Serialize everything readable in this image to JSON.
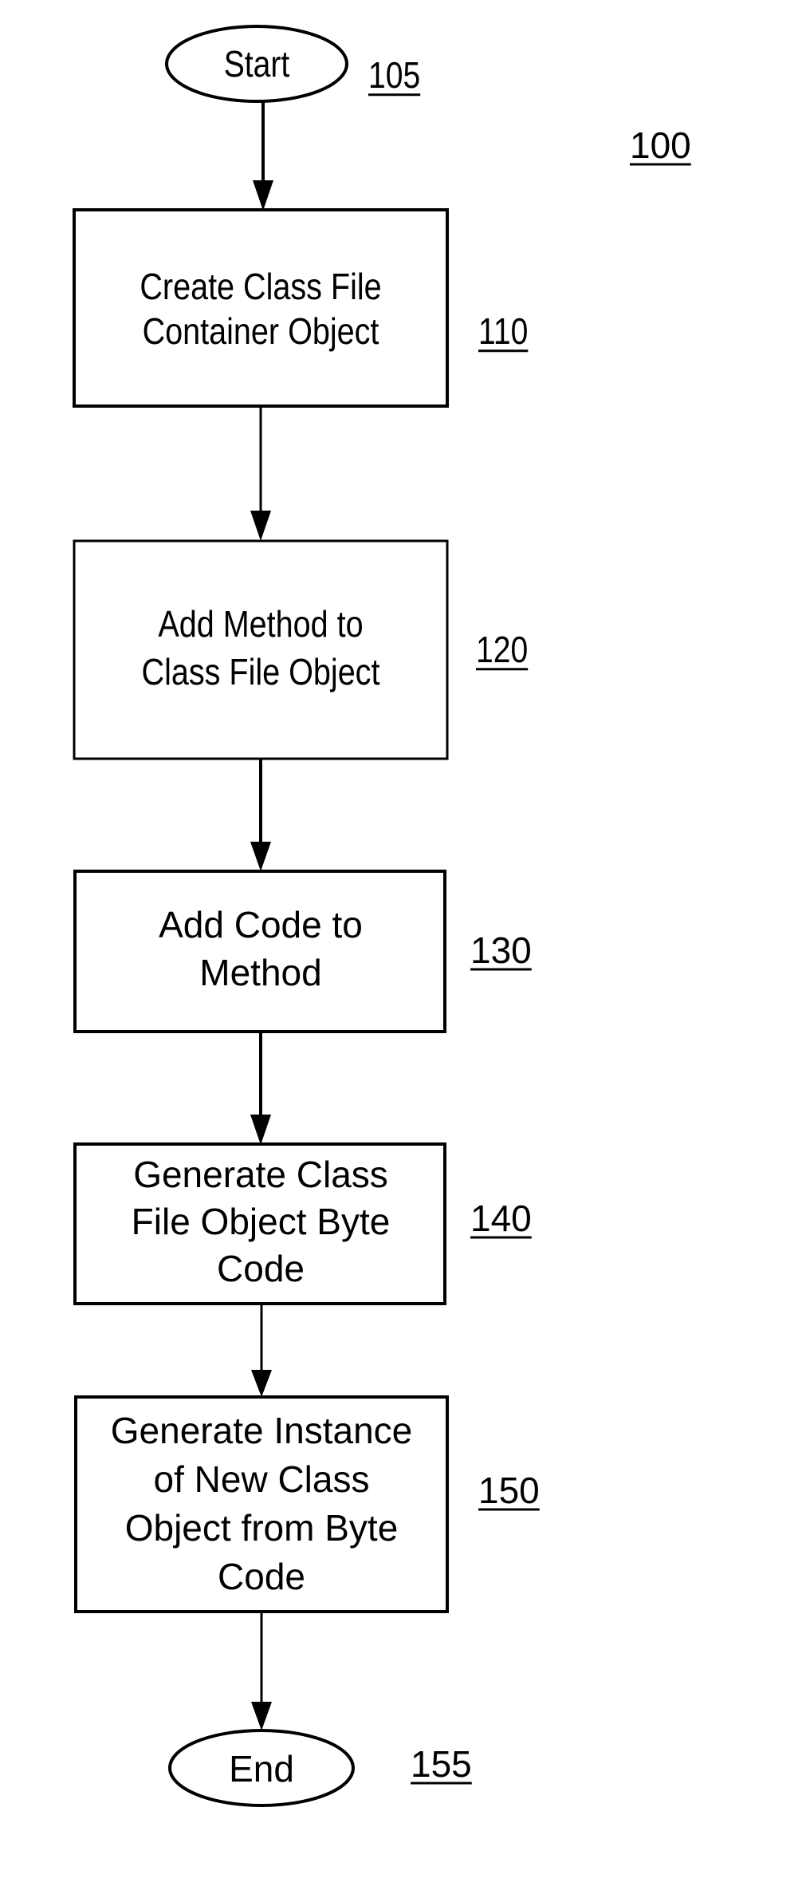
{
  "figure": {
    "label": "100"
  },
  "nodes": [
    {
      "id": "start",
      "type": "terminal",
      "lines": [
        "Start"
      ],
      "ref": "105"
    },
    {
      "id": "step-110",
      "type": "process",
      "lines": [
        "Create Class File",
        "Container Object"
      ],
      "ref": "110"
    },
    {
      "id": "step-120",
      "type": "process",
      "lines": [
        "Add Method to",
        "Class File Object"
      ],
      "ref": "120"
    },
    {
      "id": "step-130",
      "type": "process",
      "lines": [
        "Add Code to",
        "Method"
      ],
      "ref": "130"
    },
    {
      "id": "step-140",
      "type": "process",
      "lines": [
        "Generate Class",
        "File Object Byte",
        "Code"
      ],
      "ref": "140"
    },
    {
      "id": "step-150",
      "type": "process",
      "lines": [
        "Generate Instance",
        "of New Class",
        "Object from Byte",
        "Code"
      ],
      "ref": "150"
    },
    {
      "id": "end",
      "type": "terminal",
      "lines": [
        "End"
      ],
      "ref": "155"
    }
  ],
  "edges": [
    {
      "from": "start",
      "to": "step-110"
    },
    {
      "from": "step-110",
      "to": "step-120"
    },
    {
      "from": "step-120",
      "to": "step-130"
    },
    {
      "from": "step-130",
      "to": "step-140"
    },
    {
      "from": "step-140",
      "to": "step-150"
    },
    {
      "from": "step-150",
      "to": "end"
    }
  ]
}
